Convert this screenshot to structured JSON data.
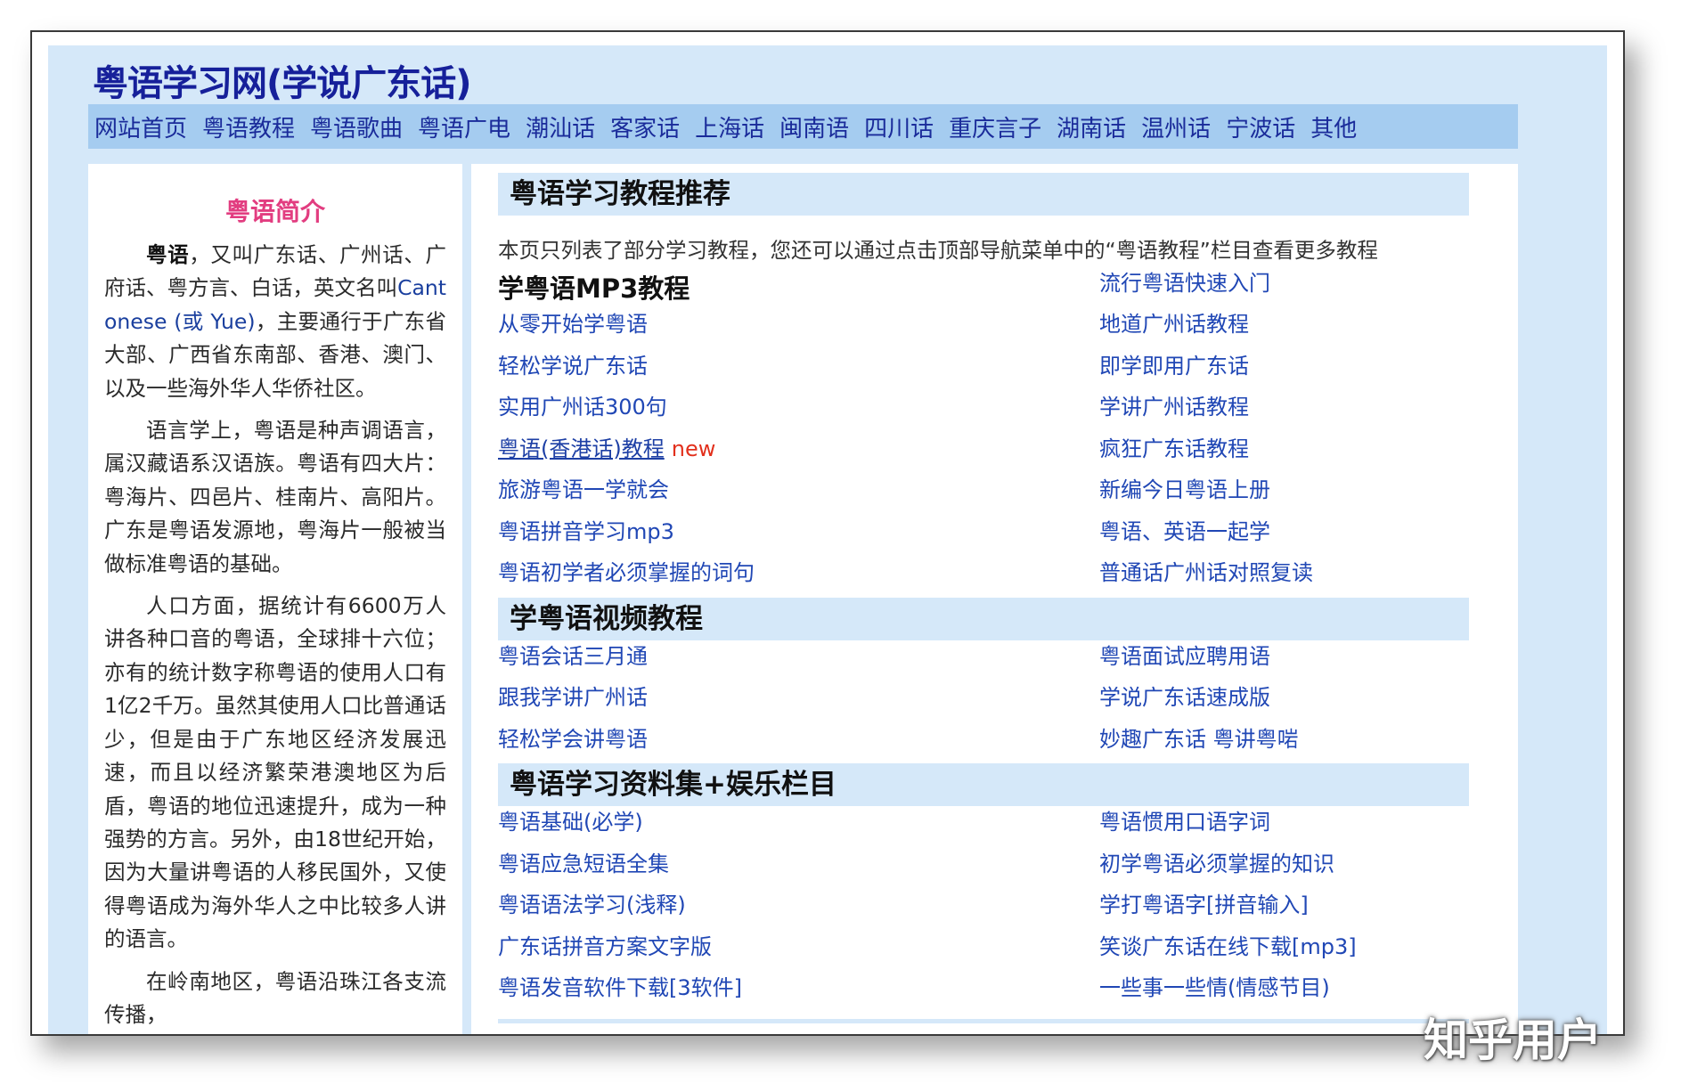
{
  "site": {
    "title": "粤语学习网(学说广东话)"
  },
  "nav": [
    "网站首页",
    "粤语教程",
    "粤语歌曲",
    "粤语广电",
    "潮汕话",
    "客家话",
    "上海话",
    "闽南语",
    "四川话",
    "重庆言子",
    "湖南话",
    "温州话",
    "宁波话",
    "其他"
  ],
  "sidebar": {
    "title": "粤语简介",
    "p1_bold": "粤语",
    "p1_a": "，又叫广东话、广州话、广府话、粤方言、白话，英文名叫",
    "p1_latin": "Cantonese (或 Yue)",
    "p1_b": "，主要通行于广东省大部、广西省东南部、香港、澳门、以及一些海外华人华侨社区。",
    "p2": "语言学上，粤语是种声调语言，属汉藏语系汉语族。粤语有四大片：粤海片、四邑片、桂南片、高阳片。广东是粤语发源地，粤海片一般被当做标准粤语的基础。",
    "p3": "人口方面，据统计有6600万人讲各种口音的粤语，全球排十六位；亦有的统计数字称粤语的使用人口有1亿2千万。虽然其使用人口比普通话少，但是由于广东地区经济发展迅速，而且以经济繁荣港澳地区为后盾，粤语的地位迅速提升，成为一种强势的方言。另外，由18世纪开始，因为大量讲粤语的人移民国外，又使得粤语成为海外华人之中比较多人讲的语言。",
    "p4": "在岭南地区，粤语沿珠江各支流传播，"
  },
  "main": {
    "section1": {
      "heading": "粤语学习教程推荐",
      "intro": "本页只列表了部分学习教程，您还可以通过点击顶部导航菜单中的“粤语教程”栏目查看更多教程",
      "sublabel": "学粤语MP3教程",
      "left": [
        "从零开始学粤语",
        "轻松学说广东话",
        "实用广州话300句",
        "粤语(香港话)教程",
        "旅游粤语一学就会",
        "粤语拼音学习mp3",
        "粤语初学者必须掌握的词句"
      ],
      "new_tag": "new",
      "right": [
        "流行粤语快速入门",
        "地道广州话教程",
        "即学即用广东话",
        "学讲广州话教程",
        "疯狂广东话教程",
        "新编今日粤语上册",
        "粤语、英语一起学",
        "普通话广州话对照复读"
      ]
    },
    "section2": {
      "heading": "学粤语视频教程",
      "left": [
        "粤语会话三月通",
        "跟我学讲广州话",
        "轻松学会讲粤语"
      ],
      "right": [
        "粤语面试应聘用语",
        "学说广东话速成版",
        "妙趣广东话 粤讲粤啱"
      ]
    },
    "section3": {
      "heading": "粤语学习资料集+娱乐栏目",
      "left": [
        "粤语基础(必学)",
        "粤语应急短语全集",
        "粤语语法学习(浅释)",
        "广东话拼音方案文字版",
        "粤语发音软件下载[3软件]"
      ],
      "right": [
        "粤语惯用口语字词",
        "初学粤语必须掌握的知识",
        "学打粤语字[拼音输入]",
        "笑谈广东话在线下载[mp3]",
        "一些事一些情(情感节目)"
      ]
    }
  },
  "watermark": "知乎用户"
}
